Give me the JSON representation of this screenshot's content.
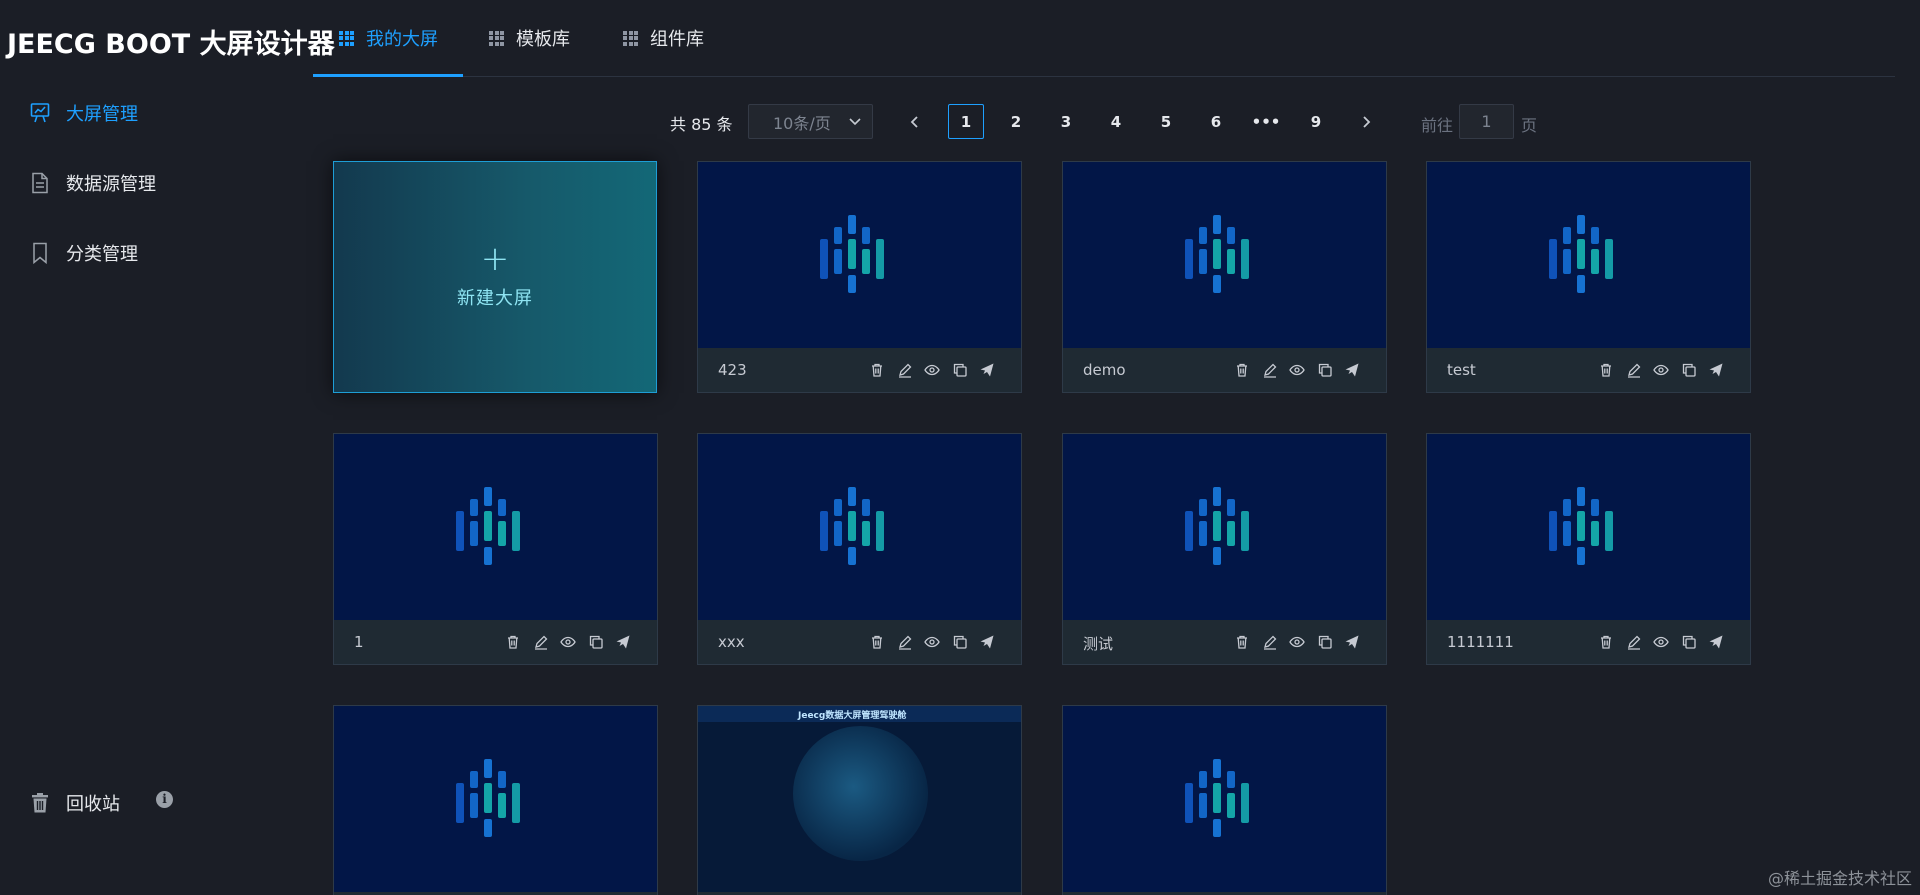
{
  "app": {
    "title": "JEECG BOOT 大屏设计器"
  },
  "tabs": [
    {
      "label": "我的大屏",
      "active": true
    },
    {
      "label": "模板库",
      "active": false
    },
    {
      "label": "组件库",
      "active": false
    }
  ],
  "sidebar": {
    "items": [
      {
        "label": "大屏管理",
        "icon": "presentation-icon",
        "active": true
      },
      {
        "label": "数据源管理",
        "icon": "document-icon",
        "active": false
      },
      {
        "label": "分类管理",
        "icon": "bookmark-icon",
        "active": false
      }
    ],
    "recycle": {
      "label": "回收站",
      "icon": "trash-icon"
    }
  },
  "pagination": {
    "total_text": "共 85 条",
    "page_size": "10条/页",
    "pages": [
      "1",
      "2",
      "3",
      "4",
      "5",
      "6",
      "•••",
      "9"
    ],
    "current": "1",
    "goto_prefix": "前往",
    "goto_value": "1",
    "goto_suffix": "页"
  },
  "new_card": {
    "plus": "+",
    "label": "新建大屏"
  },
  "cards": [
    {
      "name": "423"
    },
    {
      "name": "demo"
    },
    {
      "name": "test"
    },
    {
      "name": "1"
    },
    {
      "name": "xxx"
    },
    {
      "name": "测试"
    },
    {
      "name": "1111111"
    },
    {
      "name": ""
    },
    {
      "name": ""
    },
    {
      "name": ""
    }
  ],
  "preview_card": {
    "title": "Jeecg数据大屏管理驾驶舱"
  },
  "card_actions": [
    "trash-icon",
    "edit-icon",
    "eye-icon",
    "copy-icon",
    "send-icon"
  ],
  "watermark": "@稀土掘金技术社区",
  "colors": {
    "accent": "#1ea0ff",
    "background": "#1b1e26",
    "thumb": "#021647",
    "new_card": "#16596a"
  }
}
